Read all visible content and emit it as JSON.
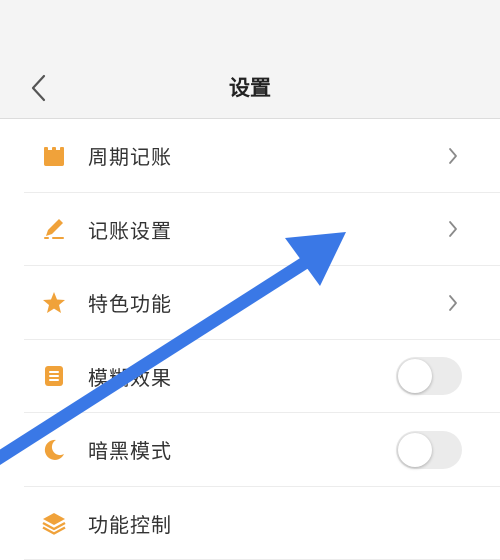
{
  "colors": {
    "accent": "#f0a23a",
    "arrow": "#3a78e6"
  },
  "nav": {
    "title": "设置",
    "back_icon": "chevron-left-icon"
  },
  "settings_items": [
    {
      "label": "周期记账",
      "icon": "calendar-icon",
      "control": "chevron"
    },
    {
      "label": "记账设置",
      "icon": "pen-icon",
      "control": "chevron"
    },
    {
      "label": "特色功能",
      "icon": "star-icon",
      "control": "chevron"
    },
    {
      "label": "模糊效果",
      "icon": "blur-icon",
      "control": "toggle",
      "toggle_on": false
    },
    {
      "label": "暗黑模式",
      "icon": "moon-icon",
      "control": "toggle",
      "toggle_on": false
    },
    {
      "label": "功能控制",
      "icon": "layers-icon",
      "control": "none"
    }
  ]
}
